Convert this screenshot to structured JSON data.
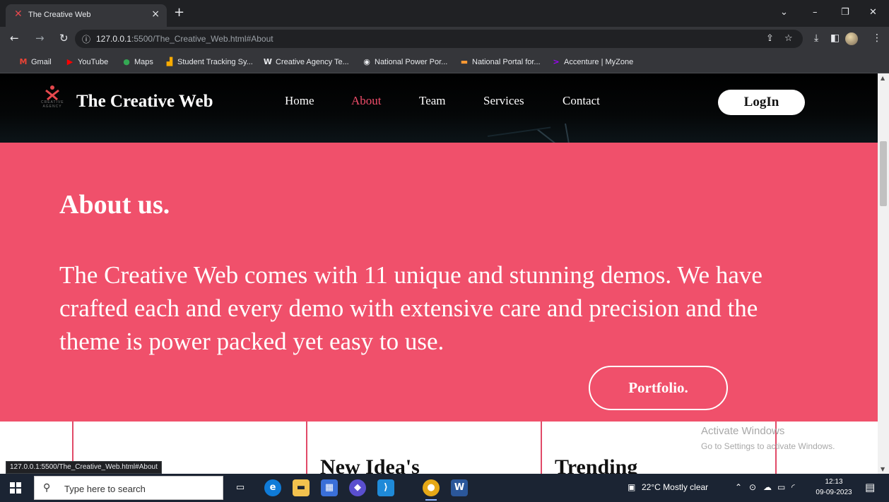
{
  "browser": {
    "tab_title": "The Creative Web",
    "tab_favicon": "x-logo-icon",
    "tab_close": "×",
    "new_tab": "+",
    "url_host": "127.0.0.1",
    "url_rest": ":5500/The_Creative_Web.html#About",
    "bookmarks": [
      {
        "label": "Gmail",
        "icon": "gmail-icon",
        "glyph": "M",
        "color": "#ea4335"
      },
      {
        "label": "YouTube",
        "icon": "youtube-icon",
        "glyph": "▶",
        "color": "#ff0000"
      },
      {
        "label": "Maps",
        "icon": "maps-icon",
        "glyph": "●",
        "color": "#34a853"
      },
      {
        "label": "Student Tracking Sy...",
        "icon": "chart-icon",
        "glyph": "▟",
        "color": "#f9ab00"
      },
      {
        "label": "Creative Agency Te...",
        "icon": "w-icon",
        "glyph": "W",
        "color": "#e8eaed"
      },
      {
        "label": "National Power Por...",
        "icon": "globe-icon",
        "glyph": "◉",
        "color": "#e8eaed"
      },
      {
        "label": "National Portal for...",
        "icon": "india-flag-icon",
        "glyph": "▬",
        "color": "#ff9933"
      },
      {
        "label": "Accenture | MyZone",
        "icon": "accenture-icon",
        "glyph": ">",
        "color": "#a100ff"
      }
    ],
    "status_url": "127.0.0.1:5500/The_Creative_Web.html#About"
  },
  "site": {
    "brand": "The Creative Web",
    "logo_sub": "CREATIVE AGENCY",
    "nav": [
      {
        "label": "Home",
        "active": false
      },
      {
        "label": "About",
        "active": true
      },
      {
        "label": "Team",
        "active": false
      },
      {
        "label": "Services",
        "active": false
      },
      {
        "label": "Contact",
        "active": false
      }
    ],
    "login_label": "LogIn",
    "accent_color": "#f0506b"
  },
  "about": {
    "title": "About us.",
    "body": "The Creative Web comes with 11 unique and stunning demos. We have crafted each and every demo with extensive care and precision and the theme is power packed yet easy to use.",
    "button": "Portfolio."
  },
  "cards": [
    {
      "title": ""
    },
    {
      "title": "New Idea's"
    },
    {
      "title": "Trending"
    }
  ],
  "watermark": {
    "line1": "Activate Windows",
    "line2": "Go to Settings to activate Windows."
  },
  "taskbar": {
    "search_placeholder": "Type here to search",
    "weather": "22°C  Mostly clear",
    "time": "12:13",
    "date": "09-09-2023"
  }
}
